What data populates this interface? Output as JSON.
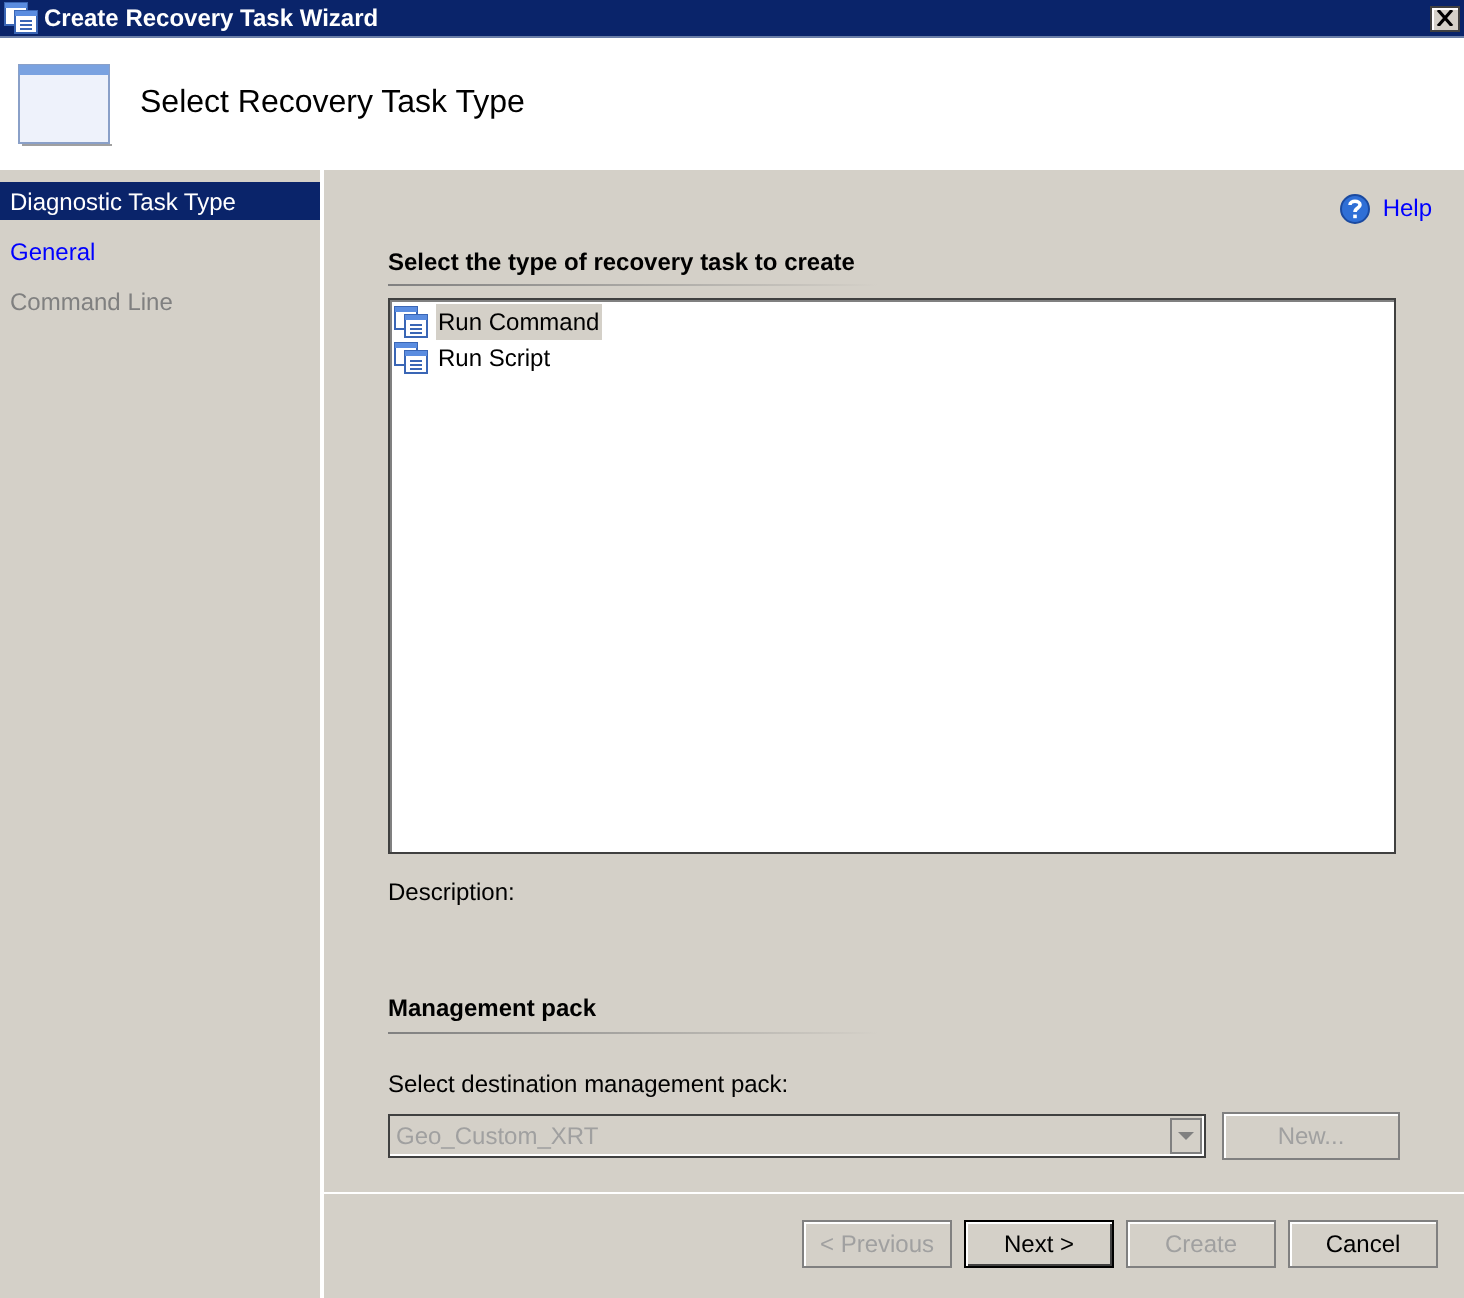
{
  "window": {
    "title": "Create Recovery Task Wizard"
  },
  "header": {
    "title": "Select Recovery Task Type"
  },
  "sidebar": {
    "items": [
      {
        "label": "Diagnostic Task Type",
        "selected": true,
        "disabled": false
      },
      {
        "label": "General",
        "selected": false,
        "disabled": false
      },
      {
        "label": "Command Line",
        "selected": false,
        "disabled": true
      }
    ]
  },
  "help": {
    "label": "Help"
  },
  "task_type": {
    "heading": "Select the type of recovery task to create",
    "items": [
      {
        "label": "Run Command",
        "selected": true
      },
      {
        "label": "Run Script",
        "selected": false
      }
    ],
    "description_label": "Description:"
  },
  "management_pack": {
    "heading": "Management pack",
    "field_label": "Select destination management pack:",
    "value": "Geo_Custom_XRT",
    "disabled": true,
    "new_button": {
      "label": "New...",
      "disabled": true
    }
  },
  "buttons": [
    {
      "label": "< Previous",
      "disabled": true,
      "default": false
    },
    {
      "label": "Next >",
      "disabled": false,
      "default": true
    },
    {
      "label": "Create",
      "disabled": true,
      "default": false
    },
    {
      "label": "Cancel",
      "disabled": false,
      "default": false
    }
  ]
}
